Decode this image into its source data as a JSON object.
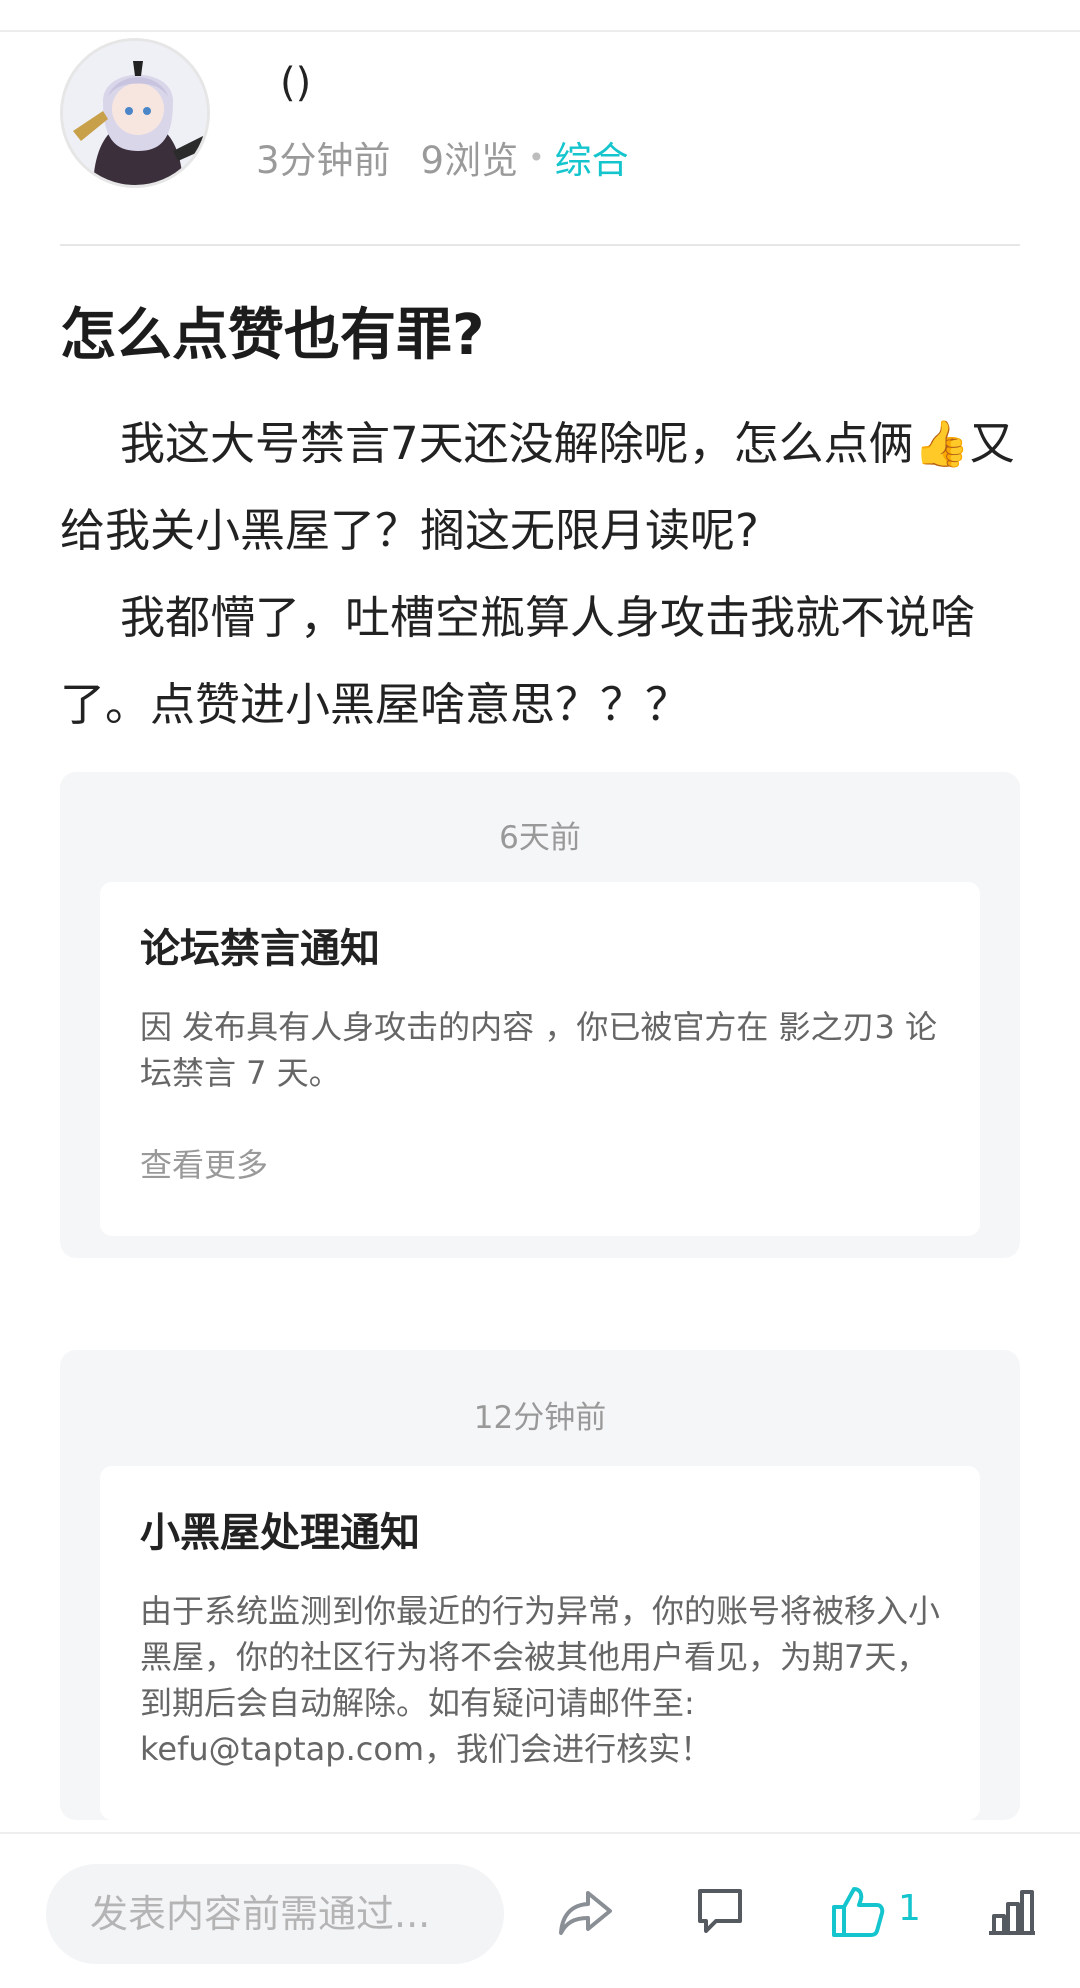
{
  "author": {
    "name": "()",
    "time": "3分钟前",
    "views": "9浏览",
    "category": "综合"
  },
  "post": {
    "title": "怎么点赞也有罪?",
    "paragraph1": "我这大号禁言7天还没解除呢，怎么点俩👍又给我关小黑屋了？搁这无限月读呢?",
    "paragraph2": "我都懵了，吐槽空瓶算人身攻击我就不说啥了。点赞进小黑屋啥意思？？？"
  },
  "notices": [
    {
      "time": "6天前",
      "title": "论坛禁言通知",
      "text": "因 发布具有人身攻击的内容 ，你已被官方在 影之刃3 论坛禁言 7 天。",
      "more": "查看更多"
    },
    {
      "time": "12分钟前",
      "title": "小黑屋处理通知",
      "text": "由于系统监测到你最近的行为异常，你的账号将被移入小黑屋，你的社区行为将不会被其他用户看见，为期7天，到期后会自动解除。如有疑问请邮件至: kefu@taptap.com，我们会进行核实！"
    }
  ],
  "bottom_bar": {
    "comment_placeholder": "发表内容前需通过...",
    "like_count": "1",
    "icons": [
      "share-icon",
      "comment-icon",
      "thumbs-up-icon",
      "stats-icon"
    ]
  },
  "colors": {
    "accent": "#15c5ce",
    "meta_gray": "#9a9a9a",
    "notice_bg": "#f5f6f8"
  }
}
